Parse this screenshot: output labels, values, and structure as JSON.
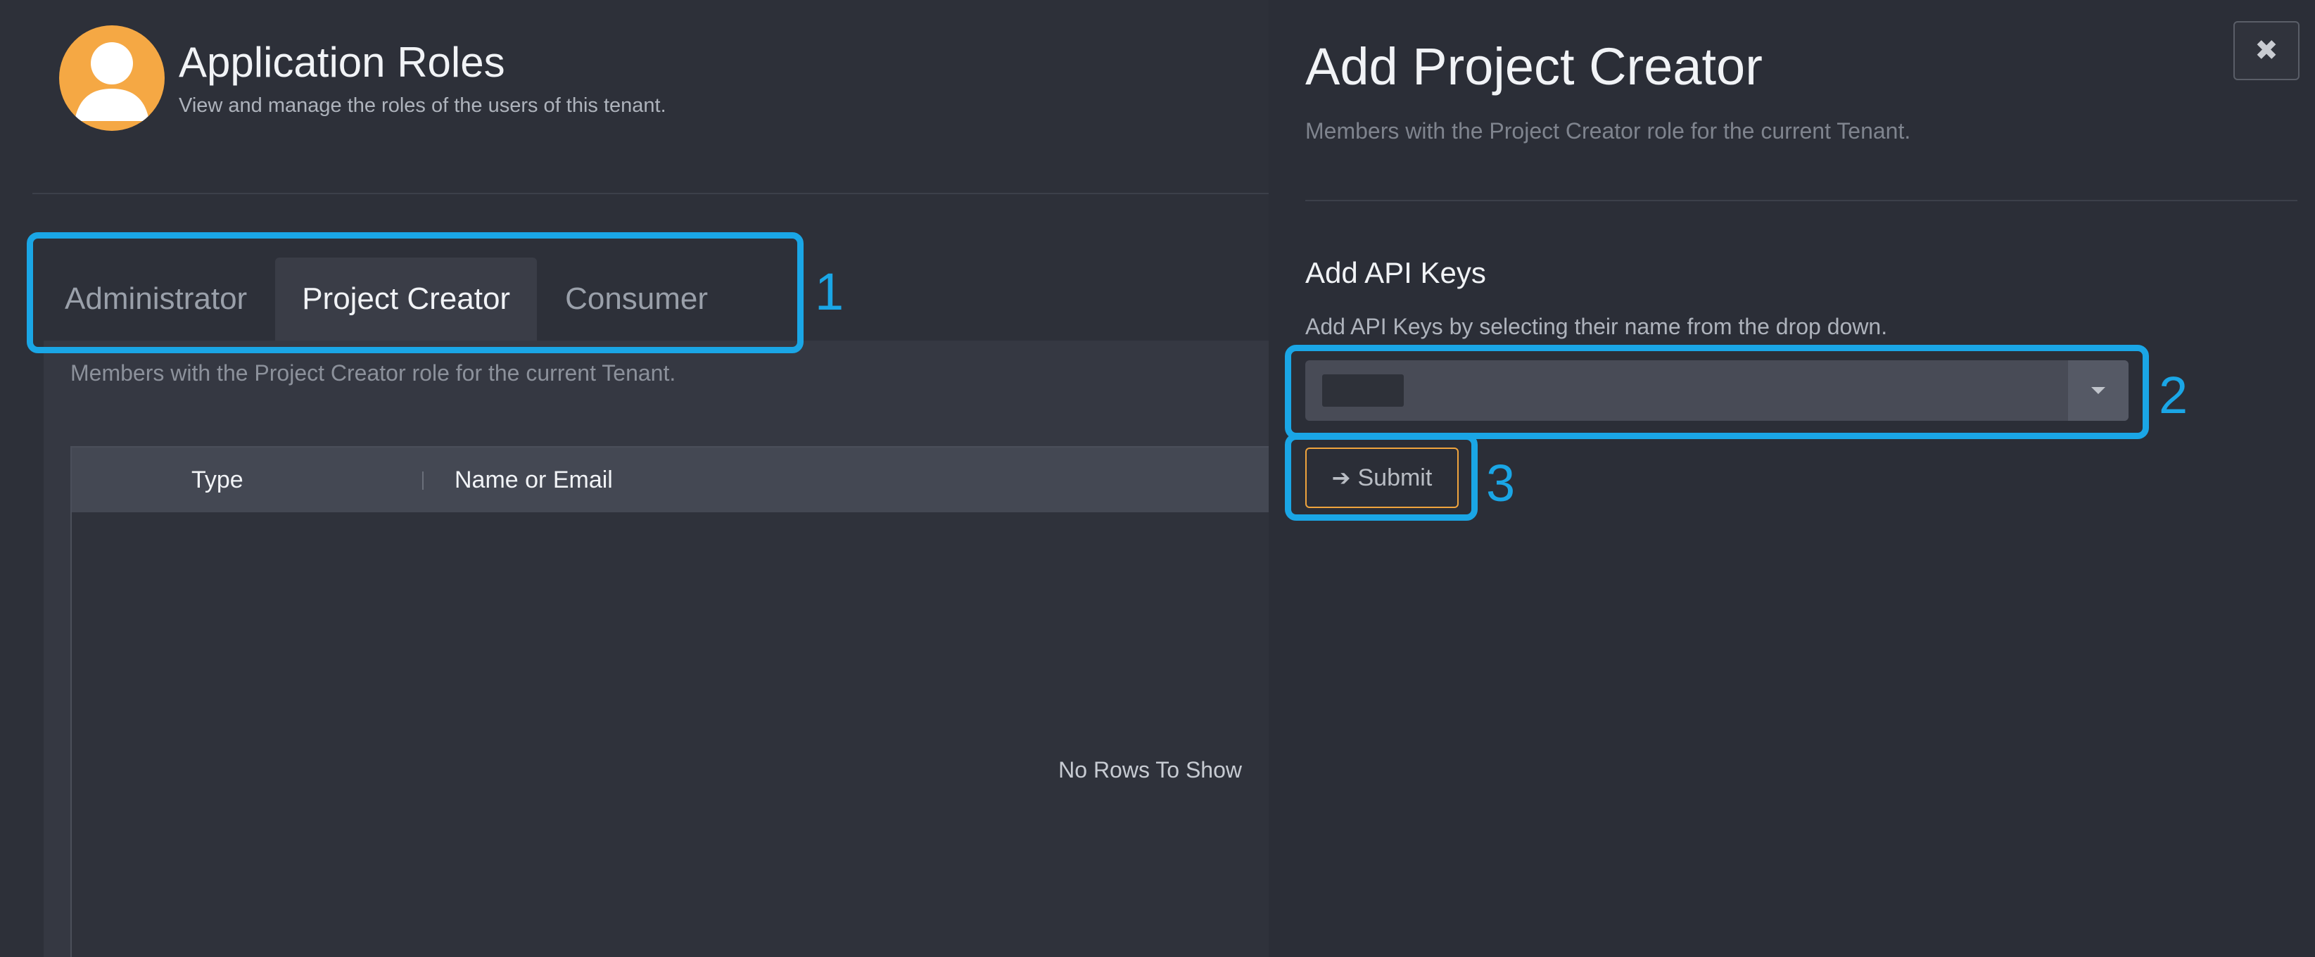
{
  "header": {
    "title": "Application Roles",
    "subtitle": "View and manage the roles of the users of this tenant.",
    "avatar_icon": "user-avatar-icon",
    "avatar_color": "#f5a844"
  },
  "tabs": [
    {
      "label": "Administrator",
      "active": false
    },
    {
      "label": "Project Creator",
      "active": true
    },
    {
      "label": "Consumer",
      "active": false
    }
  ],
  "content": {
    "description": "Members with the Project Creator role for the current Tenant.",
    "grid": {
      "columns": [
        "Type",
        "Name or Email"
      ],
      "empty_text": "No Rows To Show"
    }
  },
  "drawer": {
    "title": "Add Project Creator",
    "subtitle": "Members with the Project Creator role for the current Tenant.",
    "close_icon": "close-icon",
    "section_title": "Add API Keys",
    "section_desc": "Add API Keys by selecting their name from the drop down.",
    "submit_label": "Submit",
    "submit_icon": "arrow-right-icon",
    "accent_color": "#f0a43d"
  },
  "callouts": {
    "tabs_number": "1",
    "select_number": "2",
    "submit_number": "3",
    "color": "#1aa6e6"
  }
}
